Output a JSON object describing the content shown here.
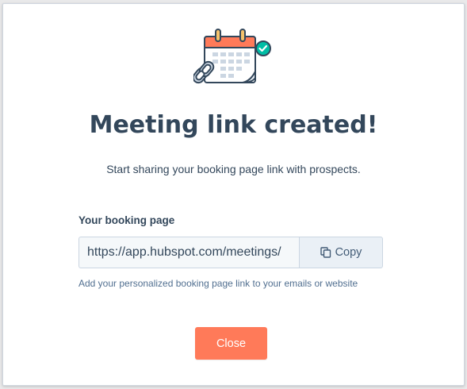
{
  "modal": {
    "title": "Meeting link created!",
    "subtitle": "Start sharing your booking page link with prospects.",
    "field_label": "Your booking page",
    "link_value": "https://app.hubspot.com/meetings/",
    "copy_label": "Copy",
    "help_text": "Add your personalized booking page link to your emails or website",
    "close_label": "Close"
  },
  "icons": {
    "illustration": "calendar-link-check-icon",
    "copy": "copy-icon"
  },
  "colors": {
    "title": "#33475b",
    "accent_orange": "#ff7a59",
    "help_text": "#516f90",
    "check_green": "#00bda5",
    "copy_bg": "#eaf0f6"
  }
}
